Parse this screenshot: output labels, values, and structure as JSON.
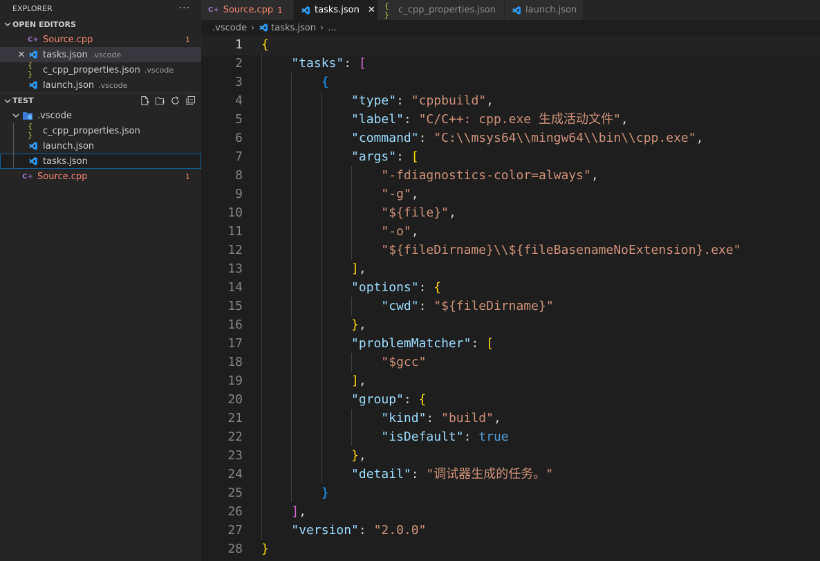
{
  "sidebar": {
    "title": "EXPLORER",
    "more": "···",
    "open_editors_label": "OPEN EDITORS",
    "open_editors": [
      {
        "name": "Source.cpp",
        "desc": "",
        "badge": "1"
      },
      {
        "name": "tasks.json",
        "desc": ".vscode",
        "badge": ""
      },
      {
        "name": "c_cpp_properties.json",
        "desc": ".vscode",
        "badge": ""
      },
      {
        "name": "launch.json",
        "desc": ".vscode",
        "badge": ""
      }
    ],
    "workspace_label": "TEST",
    "tree": [
      {
        "name": ".vscode"
      },
      {
        "name": "c_cpp_properties.json"
      },
      {
        "name": "launch.json"
      },
      {
        "name": "tasks.json"
      },
      {
        "name": "Source.cpp",
        "badge": "1"
      }
    ]
  },
  "tabs": [
    {
      "label": "Source.cpp",
      "badge": "1"
    },
    {
      "label": "tasks.json"
    },
    {
      "label": "c_cpp_properties.json"
    },
    {
      "label": "launch.json"
    }
  ],
  "breadcrumb": [
    ".vscode",
    "tasks.json",
    "..."
  ],
  "editor": {
    "current_line": 1,
    "lines": [
      {
        "n": "1",
        "tokens": [
          {
            "c": "b1",
            "t": "{"
          }
        ]
      },
      {
        "n": "2",
        "tokens": [
          {
            "c": "p",
            "t": "    "
          },
          {
            "c": "k",
            "t": "\"tasks\""
          },
          {
            "c": "p",
            "t": ": "
          },
          {
            "c": "b2",
            "t": "["
          }
        ]
      },
      {
        "n": "3",
        "tokens": [
          {
            "c": "p",
            "t": "        "
          },
          {
            "c": "b3",
            "t": "{"
          }
        ]
      },
      {
        "n": "4",
        "tokens": [
          {
            "c": "p",
            "t": "            "
          },
          {
            "c": "k",
            "t": "\"type\""
          },
          {
            "c": "p",
            "t": ": "
          },
          {
            "c": "s",
            "t": "\"cppbuild\""
          },
          {
            "c": "p",
            "t": ","
          }
        ]
      },
      {
        "n": "5",
        "tokens": [
          {
            "c": "p",
            "t": "            "
          },
          {
            "c": "k",
            "t": "\"label\""
          },
          {
            "c": "p",
            "t": ": "
          },
          {
            "c": "s",
            "t": "\"C/C++: cpp.exe 生成活动文件\""
          },
          {
            "c": "p",
            "t": ","
          }
        ]
      },
      {
        "n": "6",
        "tokens": [
          {
            "c": "p",
            "t": "            "
          },
          {
            "c": "k",
            "t": "\"command\""
          },
          {
            "c": "p",
            "t": ": "
          },
          {
            "c": "s",
            "t": "\"C:\\\\msys64\\\\mingw64\\\\bin\\\\cpp.exe\""
          },
          {
            "c": "p",
            "t": ","
          }
        ]
      },
      {
        "n": "7",
        "tokens": [
          {
            "c": "p",
            "t": "            "
          },
          {
            "c": "k",
            "t": "\"args\""
          },
          {
            "c": "p",
            "t": ": "
          },
          {
            "c": "b1",
            "t": "["
          }
        ]
      },
      {
        "n": "8",
        "tokens": [
          {
            "c": "p",
            "t": "                "
          },
          {
            "c": "s",
            "t": "\"-fdiagnostics-color=always\""
          },
          {
            "c": "p",
            "t": ","
          }
        ]
      },
      {
        "n": "9",
        "tokens": [
          {
            "c": "p",
            "t": "                "
          },
          {
            "c": "s",
            "t": "\"-g\""
          },
          {
            "c": "p",
            "t": ","
          }
        ]
      },
      {
        "n": "10",
        "tokens": [
          {
            "c": "p",
            "t": "                "
          },
          {
            "c": "s",
            "t": "\"${file}\""
          },
          {
            "c": "p",
            "t": ","
          }
        ]
      },
      {
        "n": "11",
        "tokens": [
          {
            "c": "p",
            "t": "                "
          },
          {
            "c": "s",
            "t": "\"-o\""
          },
          {
            "c": "p",
            "t": ","
          }
        ]
      },
      {
        "n": "12",
        "tokens": [
          {
            "c": "p",
            "t": "                "
          },
          {
            "c": "s",
            "t": "\"${fileDirname}\\\\${fileBasenameNoExtension}.exe\""
          }
        ]
      },
      {
        "n": "13",
        "tokens": [
          {
            "c": "p",
            "t": "            "
          },
          {
            "c": "b1",
            "t": "]"
          },
          {
            "c": "p",
            "t": ","
          }
        ]
      },
      {
        "n": "14",
        "tokens": [
          {
            "c": "p",
            "t": "            "
          },
          {
            "c": "k",
            "t": "\"options\""
          },
          {
            "c": "p",
            "t": ": "
          },
          {
            "c": "b1",
            "t": "{"
          }
        ]
      },
      {
        "n": "15",
        "tokens": [
          {
            "c": "p",
            "t": "                "
          },
          {
            "c": "k",
            "t": "\"cwd\""
          },
          {
            "c": "p",
            "t": ": "
          },
          {
            "c": "s",
            "t": "\"${fileDirname}\""
          }
        ]
      },
      {
        "n": "16",
        "tokens": [
          {
            "c": "p",
            "t": "            "
          },
          {
            "c": "b1",
            "t": "}"
          },
          {
            "c": "p",
            "t": ","
          }
        ]
      },
      {
        "n": "17",
        "tokens": [
          {
            "c": "p",
            "t": "            "
          },
          {
            "c": "k",
            "t": "\"problemMatcher\""
          },
          {
            "c": "p",
            "t": ": "
          },
          {
            "c": "b1",
            "t": "["
          }
        ]
      },
      {
        "n": "18",
        "tokens": [
          {
            "c": "p",
            "t": "                "
          },
          {
            "c": "s",
            "t": "\"$gcc\""
          }
        ]
      },
      {
        "n": "19",
        "tokens": [
          {
            "c": "p",
            "t": "            "
          },
          {
            "c": "b1",
            "t": "]"
          },
          {
            "c": "p",
            "t": ","
          }
        ]
      },
      {
        "n": "20",
        "tokens": [
          {
            "c": "p",
            "t": "            "
          },
          {
            "c": "k",
            "t": "\"group\""
          },
          {
            "c": "p",
            "t": ": "
          },
          {
            "c": "b1",
            "t": "{"
          }
        ]
      },
      {
        "n": "21",
        "tokens": [
          {
            "c": "p",
            "t": "                "
          },
          {
            "c": "k",
            "t": "\"kind\""
          },
          {
            "c": "p",
            "t": ": "
          },
          {
            "c": "s",
            "t": "\"build\""
          },
          {
            "c": "p",
            "t": ","
          }
        ]
      },
      {
        "n": "22",
        "tokens": [
          {
            "c": "p",
            "t": "                "
          },
          {
            "c": "k",
            "t": "\"isDefault\""
          },
          {
            "c": "p",
            "t": ": "
          },
          {
            "c": "t",
            "t": "true"
          }
        ]
      },
      {
        "n": "23",
        "tokens": [
          {
            "c": "p",
            "t": "            "
          },
          {
            "c": "b1",
            "t": "}"
          },
          {
            "c": "p",
            "t": ","
          }
        ]
      },
      {
        "n": "24",
        "tokens": [
          {
            "c": "p",
            "t": "            "
          },
          {
            "c": "k",
            "t": "\"detail\""
          },
          {
            "c": "p",
            "t": ": "
          },
          {
            "c": "s",
            "t": "\"调试器生成的任务。\""
          }
        ]
      },
      {
        "n": "25",
        "tokens": [
          {
            "c": "p",
            "t": "        "
          },
          {
            "c": "b3",
            "t": "}"
          }
        ]
      },
      {
        "n": "26",
        "tokens": [
          {
            "c": "p",
            "t": "    "
          },
          {
            "c": "b2",
            "t": "]"
          },
          {
            "c": "p",
            "t": ","
          }
        ]
      },
      {
        "n": "27",
        "tokens": [
          {
            "c": "p",
            "t": "    "
          },
          {
            "c": "k",
            "t": "\"version\""
          },
          {
            "c": "p",
            "t": ": "
          },
          {
            "c": "s",
            "t": "\"2.0.0\""
          }
        ]
      },
      {
        "n": "28",
        "tokens": [
          {
            "c": "b1",
            "t": "}"
          }
        ]
      }
    ]
  },
  "colors": {
    "error": "#f48771",
    "json_key": "#9cdcfe",
    "json_string": "#ce9178",
    "bracket_gold": "#ffd700",
    "bracket_purple": "#da70d6",
    "bracket_blue": "#179fff",
    "keyword": "#569cd6"
  },
  "icons": [
    "ellipsis-icon",
    "chevron-down-icon",
    "cpp-file-icon",
    "vscode-icon",
    "json-braces-icon",
    "close-icon",
    "new-file-icon",
    "new-folder-icon",
    "refresh-icon",
    "collapse-all-icon",
    "vscode-folder-icon"
  ]
}
